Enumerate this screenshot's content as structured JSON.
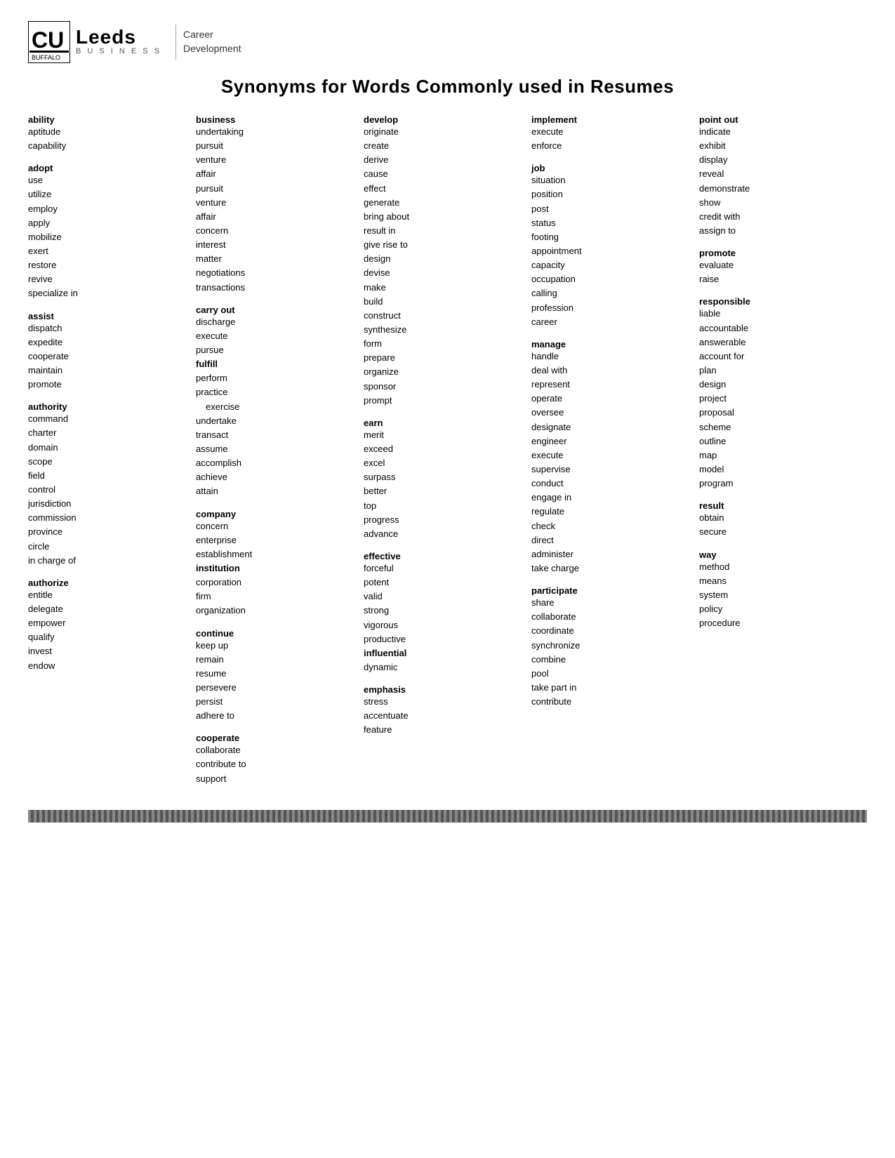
{
  "header": {
    "logo_leeds": "Leeds",
    "logo_business": "B U S I N E S S",
    "logo_career": "Career",
    "logo_development": "Development"
  },
  "title": "Synonyms for Words Commonly used in Resumes",
  "columns": [
    {
      "id": "col1",
      "groups": [
        {
          "header": "ability",
          "synonyms": [
            "aptitude",
            "capability"
          ]
        },
        {
          "header": "adopt",
          "synonyms": [
            "use",
            "utilize",
            "employ",
            "apply",
            "mobilize",
            "exert",
            "restore",
            "revive",
            "specialize in"
          ]
        },
        {
          "header": "assist",
          "synonyms": [
            "dispatch",
            "expedite",
            "cooperate",
            "maintain",
            "promote"
          ]
        },
        {
          "header": "authority",
          "synonyms": [
            "command",
            "charter",
            "domain",
            "scope",
            "field",
            "control",
            "jurisdiction",
            "commission",
            "province",
            "circle",
            "in charge of"
          ]
        },
        {
          "header": "authorize",
          "synonyms": [
            "entitle",
            "delegate",
            "empower",
            "qualify",
            "invest",
            "endow"
          ]
        }
      ]
    },
    {
      "id": "col2",
      "groups": [
        {
          "header": "business",
          "synonyms": [
            "undertaking",
            "pursuit",
            "venture",
            "affair",
            "pursuit",
            "venture",
            "affair",
            "concern",
            "interest",
            "matter",
            "negotiations",
            "transactions"
          ]
        },
        {
          "header": "carry out",
          "synonyms": [
            "discharge",
            "execute",
            "pursue",
            "fulfill",
            "perform",
            "practice",
            "    exercise",
            "undertake",
            "transact",
            "assume",
            "accomplish",
            "achieve",
            "attain"
          ]
        },
        {
          "header": "company",
          "synonyms": [
            "concern",
            "enterprise",
            "establishment",
            "institution",
            "corporation",
            "firm",
            "organization"
          ]
        },
        {
          "header": "continue",
          "synonyms": [
            "keep up",
            "remain",
            "resume",
            "persevere",
            "persist",
            "adhere to"
          ]
        },
        {
          "header": "cooperate",
          "synonyms": [
            "collaborate",
            "contribute to",
            "support"
          ]
        }
      ]
    },
    {
      "id": "col3",
      "groups": [
        {
          "header": "develop",
          "synonyms": [
            "originate",
            "create",
            "derive",
            "cause",
            "effect",
            "generate",
            "bring about",
            "result in",
            "give rise to",
            "design",
            "devise",
            "make",
            "build",
            "construct",
            "synthesize",
            "form",
            "prepare",
            "organize",
            "sponsor",
            "prompt"
          ]
        },
        {
          "header": "earn",
          "synonyms": [
            "merit",
            "exceed",
            "excel",
            "surpass",
            "better",
            "top",
            "progress",
            "advance"
          ]
        },
        {
          "header": "effective",
          "synonyms": [
            "forceful",
            "potent",
            "valid",
            "strong",
            "vigorous",
            "productive",
            "influential",
            "dynamic"
          ]
        },
        {
          "header": "emphasis",
          "synonyms": [
            "stress",
            "accentuate",
            "feature"
          ]
        }
      ]
    },
    {
      "id": "col4",
      "groups": [
        {
          "header": "implement",
          "synonyms": [
            "execute",
            "enforce"
          ]
        },
        {
          "header": "job",
          "synonyms": [
            "situation",
            "position",
            "post",
            "status",
            "footing",
            "appointment",
            "capacity",
            "occupation",
            "calling",
            "profession",
            "career"
          ]
        },
        {
          "header": "manage",
          "synonyms": [
            "handle",
            "deal with",
            "represent",
            "operate",
            "oversee",
            "designate",
            "engineer",
            "execute",
            "supervise",
            "conduct",
            "engage in",
            "regulate",
            "check",
            "direct",
            "administer",
            "take charge"
          ]
        },
        {
          "header": "participate",
          "synonyms": [
            "share",
            "collaborate",
            "coordinate",
            "synchronize",
            "combine",
            "pool",
            "take part in",
            "contribute"
          ]
        }
      ]
    },
    {
      "id": "col5",
      "groups": [
        {
          "header": "point out",
          "synonyms": [
            "indicate",
            "exhibit",
            "display",
            "reveal",
            "demonstrate",
            "show",
            "credit with",
            "assign to"
          ]
        },
        {
          "header": "promote",
          "synonyms": [
            "evaluate",
            "raise"
          ]
        },
        {
          "header": "responsible",
          "synonyms": [
            "liable",
            "accountable",
            "answerable",
            "account for",
            "plan",
            "design",
            "project",
            "proposal",
            "scheme",
            "outline",
            "map",
            "model",
            "program"
          ]
        },
        {
          "header": "result",
          "synonyms": [
            "obtain",
            "secure"
          ]
        },
        {
          "header": "way",
          "synonyms": [
            "method",
            "means",
            "system",
            "policy",
            "procedure"
          ]
        }
      ]
    }
  ]
}
